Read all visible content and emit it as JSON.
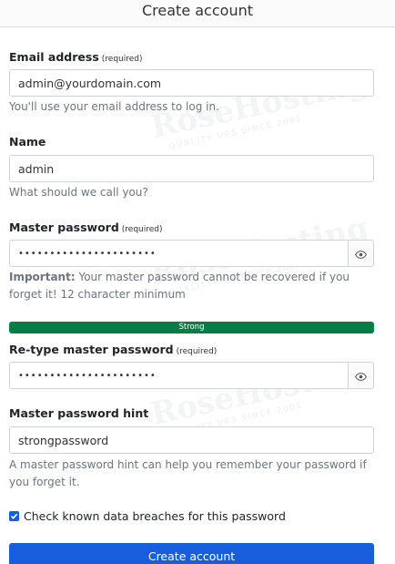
{
  "header": {
    "title": "Create account"
  },
  "required_label": "(required)",
  "email": {
    "label": "Email address",
    "value": "admin@yourdomain.com",
    "helper": "You'll use your email address to log in."
  },
  "name": {
    "label": "Name",
    "value": "admin",
    "helper": "What should we call you?"
  },
  "master_password": {
    "label": "Master password",
    "value": "••••••••••••••••••••••",
    "important_label": "Important:",
    "helper": "Your master password cannot be recovered if you forget it! 12 character minimum",
    "toggle_icon": "eye-icon"
  },
  "strength": {
    "label": "Strong",
    "fraction": 1.0,
    "color": "#017e45"
  },
  "retype_password": {
    "label": "Re-type master password",
    "value": "••••••••••••••••••••••",
    "toggle_icon": "eye-icon"
  },
  "hint": {
    "label": "Master password hint",
    "value": "strongpassword",
    "helper": "A master password hint can help you remember your password if you forget it."
  },
  "breach_check": {
    "label": "Check known data breaches for this password",
    "checked": true
  },
  "submit": {
    "label": "Create account",
    "color": "#175ddc"
  },
  "watermark": {
    "brand": "RoseHosting",
    "tagline": "QUALITY VPS SINCE 2001"
  }
}
